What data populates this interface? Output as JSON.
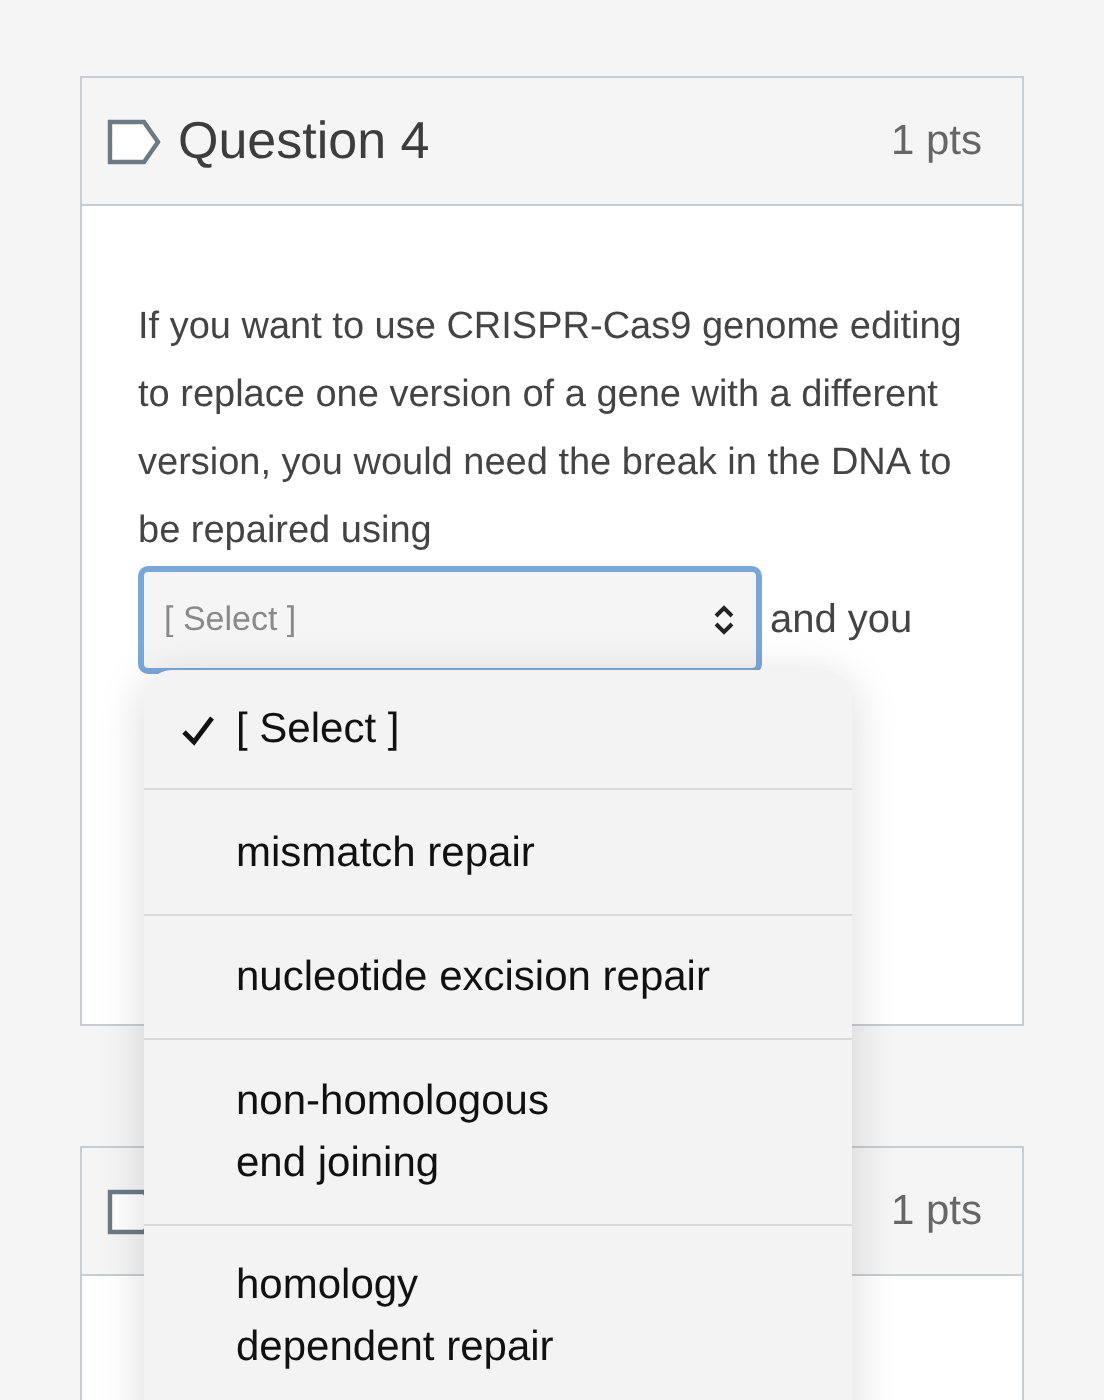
{
  "questions": [
    {
      "title": "Question 4",
      "points": "1 pts",
      "text": "If you want to use CRISPR-Cas9 genome editing to replace one version of a gene with a different version, you would need the break in the DNA to be repaired using",
      "select": {
        "value": "[ Select ]",
        "focused": true
      },
      "after_text": "and you"
    },
    {
      "points": "1 pts"
    }
  ],
  "dropdown": {
    "options": [
      {
        "label": "[ Select ]",
        "selected": true
      },
      {
        "label": "mismatch repair",
        "selected": false
      },
      {
        "label": "nucleotide excision repair",
        "selected": false
      },
      {
        "label": "non-homologous\nend joining",
        "selected": false
      },
      {
        "label": "homology\ndependent repair",
        "selected": false
      }
    ]
  }
}
